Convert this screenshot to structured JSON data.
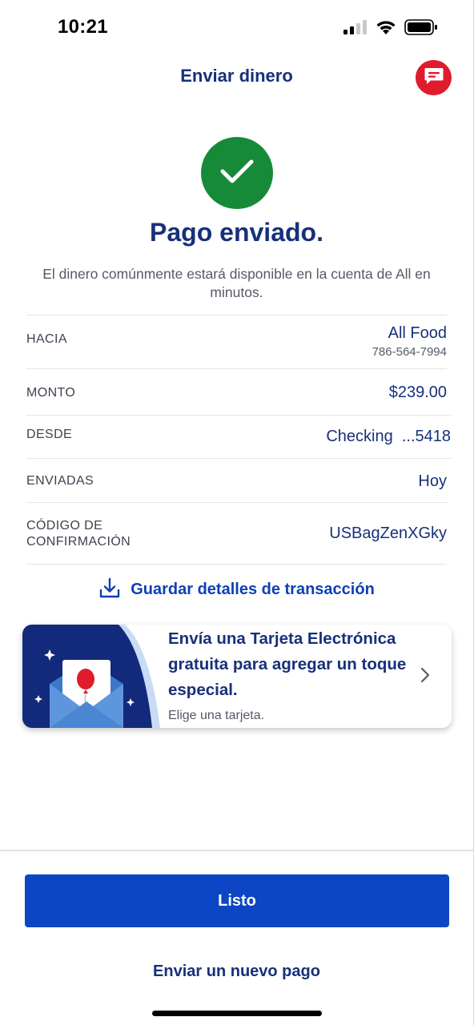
{
  "status_bar": {
    "time": "10:21",
    "icons": [
      "cellular-signal-icon",
      "wifi-icon",
      "battery-icon"
    ]
  },
  "header": {
    "title": "Enviar dinero",
    "chat_icon": "chat-icon"
  },
  "confirmation": {
    "icon": "checkmark-icon",
    "title": "Pago enviado.",
    "subtitle": "El dinero comúnmente estará disponible en la cuenta de All en minutos."
  },
  "details": {
    "to_label": "HACIA",
    "to_name": "All Food",
    "to_phone": "786-564-7994",
    "amount_label": "MONTO",
    "amount_value": "$239.00",
    "from_label": "DESDE",
    "from_value": "Checking  ...5418",
    "sent_label": "ENVIADAS",
    "sent_value": "Hoy",
    "code_label_line1": "CÓDIGO DE",
    "code_label_line2": "CONFIRMACIÓN",
    "code_value": "USBagZenXGky"
  },
  "save_link": {
    "icon": "download-icon",
    "label": "Guardar detalles de transacción"
  },
  "ecard_promo": {
    "title": "Envía una Tarjeta Electrónica gratuita para agregar un toque especial.",
    "subtitle": "Elige una tarjeta.",
    "art_icon": "envelope-balloon-icon",
    "chevron_icon": "chevron-right-icon"
  },
  "actions": {
    "done_label": "Listo",
    "new_payment_label": "Enviar un nuevo pago"
  },
  "colors": {
    "brand_blue": "#0c46c4",
    "navy": "#17307a",
    "success_green": "#178a3a",
    "chat_red": "#e01b2c"
  }
}
